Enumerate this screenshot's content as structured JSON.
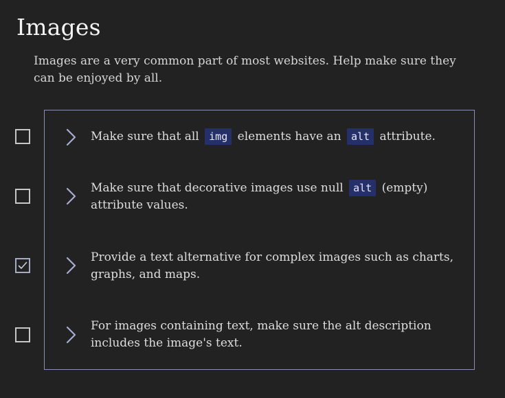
{
  "section": {
    "title": "Images",
    "intro": "Images are a very common part of most websites. Help make sure they can be enjoyed by all."
  },
  "checklist": [
    {
      "checked": false,
      "text_before": "Make sure that all",
      "code1": "img",
      "text_middle": "elements have an",
      "code2": "alt",
      "text_after": "attribute."
    },
    {
      "checked": false,
      "text_before": "Make sure that decorative images use null",
      "code1": "alt",
      "text_after": "(empty) attribute values."
    },
    {
      "checked": true,
      "text": "Provide a text alternative for complex images such as charts, graphs, and maps."
    },
    {
      "checked": false,
      "text": "For images containing text, make sure the alt description includes the image's text."
    }
  ],
  "icons": {
    "expand": "chevron-right-icon",
    "check": "checkmark-icon"
  },
  "colors": {
    "background": "#222223",
    "card_border": "#8b8fb4",
    "code_background": "#25306b"
  }
}
